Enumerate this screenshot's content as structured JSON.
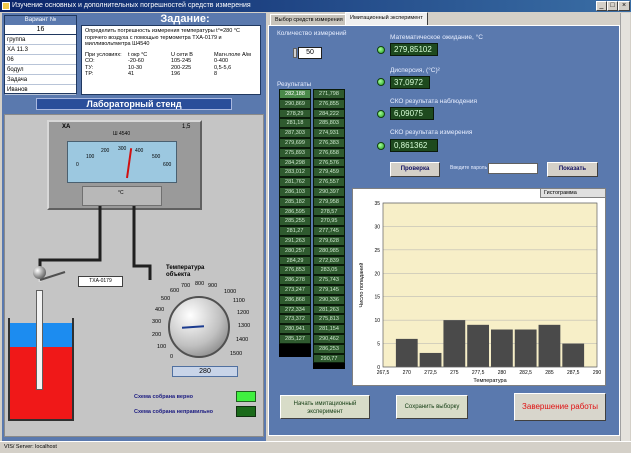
{
  "window": {
    "title": "Изучение основных и дополнительных погрешностей средств измерения",
    "minimize": "_",
    "maximize": "□",
    "close": "×"
  },
  "variant_list": {
    "header": "Вариант №",
    "selected": "16",
    "items": [
      "группа",
      "ХА 11.3",
      "06",
      "бодул",
      "Задача",
      "Иванов"
    ]
  },
  "task": {
    "title": "Задание:",
    "text": "Определить погрешность измерения температуры t°=280 °С горячего воздуха с помощью термометра ТХА-0179 и милливольтметра Ш4540",
    "table_header": [
      "При условиях:",
      "t окр °С",
      "U сети В",
      "Магн.поле А/м"
    ],
    "rows": [
      [
        "СО:",
        "-20-60",
        "105-245",
        "0-400"
      ],
      [
        "ТУ:",
        "10-30",
        "200-225",
        "0,5-5,6"
      ],
      [
        "ТР:",
        "41",
        "196",
        "8"
      ]
    ]
  },
  "stand": {
    "banner": "Лабораторный стенд",
    "meter_type": "ХА",
    "meter_model": "Ш 4540",
    "meter_class": "1,5",
    "meter_unit": "°С",
    "meter_scale": [
      "0",
      "100",
      "200",
      "300",
      "400",
      "500",
      "600"
    ],
    "tc_label": "ТХА-0179",
    "dial_title": "Температура объекта",
    "dial_scale": [
      "0",
      "100",
      "200",
      "300",
      "400",
      "500",
      "600",
      "700",
      "800",
      "900",
      "1000",
      "1100",
      "1200",
      "1300",
      "1400",
      "1500"
    ],
    "dial_value": "280",
    "status_ok": "Схема собрана верно",
    "status_bad": "Схема собрана неправильно"
  },
  "tabs": {
    "tab1": "Выбор средств измерения",
    "tab2": "Имитационный эксперимент"
  },
  "experiment": {
    "count_label": "Количество измерений",
    "count_value": "50",
    "results_label": "Результаты",
    "results_col1": [
      "282,188",
      "290,869",
      "278,29",
      "281,18",
      "287,303",
      "279,699",
      "275,893",
      "284,298",
      "283,012",
      "281,762",
      "286,103",
      "285,182",
      "286,595",
      "285,255",
      "281,27",
      "291,263",
      "280,257",
      "284,29",
      "276,853",
      "286,278",
      "273,247",
      "286,868",
      "272,334",
      "273,372",
      "280,941",
      "285,127"
    ],
    "results_col2": [
      "271,798",
      "276,855",
      "284,222",
      "285,803",
      "274,931",
      "276,383",
      "276,658",
      "276,576",
      "279,459",
      "276,557",
      "290,397",
      "279,958",
      "278,57",
      "270,95",
      "277,745",
      "279,628",
      "280,985",
      "272,839",
      "283,05",
      "275,743",
      "279,145",
      "290,336",
      "281,263",
      "275,813",
      "281,154",
      "290,462",
      "286,253",
      "290,77"
    ],
    "stats": [
      {
        "label": "Математическое ожидание, °С",
        "value": "279,85102"
      },
      {
        "label": "Дисперсия, (°С)²",
        "value": "37,0972"
      },
      {
        "label": "СКО результата наблюдения",
        "value": "6,09075"
      },
      {
        "label": "СКО результата измерения",
        "value": "0,861362"
      }
    ],
    "check_button": "Проверка",
    "password_label": "Введите пароль",
    "show_button": "Показать",
    "start_button": "Начать имитационный эксперимент",
    "save_button": "Сохранить выборку",
    "exit_button": "Завершение работы"
  },
  "chart_data": {
    "type": "bar",
    "title": "Гистограмма",
    "xlabel": "Температура",
    "ylabel": "Число попаданий",
    "x_ticks": [
      "267,5",
      "270",
      "272,5",
      "275",
      "277,5",
      "280",
      "282,5",
      "285",
      "287,5",
      "290"
    ],
    "y_ticks": [
      "0",
      "5",
      "10",
      "15",
      "20",
      "25",
      "30",
      "35"
    ],
    "ylim": [
      0,
      35
    ],
    "categories": [
      "270",
      "272,5",
      "275",
      "277,5",
      "280",
      "282,5",
      "285",
      "287,5",
      "290"
    ],
    "values": [
      6,
      3,
      10,
      9,
      8,
      8,
      9,
      5
    ],
    "bar_edges": [
      268.75,
      271.25,
      273.75,
      276.25,
      278.75,
      281.25,
      283.75,
      286.25,
      288.75
    ],
    "xlim": [
      267.5,
      290
    ],
    "colors": {
      "background": "#f7efc8",
      "bar": "#4a4a4a",
      "grid": "#b0b0b0"
    }
  },
  "taskbar": {
    "item1": "VIS/ Server: localhost"
  },
  "colors": {
    "panel_blue": "#5a79ae",
    "display_green": "#1e4a1e",
    "tank_blue": "#1c8cf0",
    "tank_red": "#f01818",
    "exit_red": "#e01010"
  }
}
